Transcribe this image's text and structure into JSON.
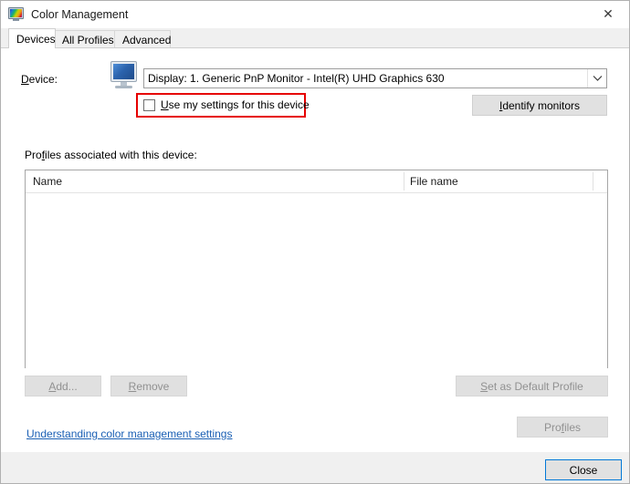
{
  "window": {
    "title": "Color Management",
    "icon": "color-monitor-icon",
    "close_glyph": "✕"
  },
  "tabs": [
    {
      "id": "devices",
      "label": "Devices",
      "selected": true
    },
    {
      "id": "all-profiles",
      "label": "All Profiles",
      "selected": false
    },
    {
      "id": "advanced",
      "label": "Advanced",
      "selected": false
    }
  ],
  "device_section": {
    "label": "Device:",
    "label_accel": "D",
    "icon": "monitor-icon",
    "combo_value": "Display: 1. Generic PnP Monitor - Intel(R) UHD Graphics 630",
    "combo_arrow_icon": "chevron-down-icon",
    "use_settings_label": "Use my settings for this device",
    "use_settings_accel": "U",
    "use_settings_checked": false,
    "identify_button": "Identify monitors",
    "identify_accel": "I",
    "highlight_color": "#e60000"
  },
  "profiles_section": {
    "label": "Profiles associated with this device:",
    "label_accel": "f",
    "columns": [
      "Name",
      "File name"
    ],
    "rows": [],
    "buttons": {
      "add": "Add...",
      "add_accel": "A",
      "remove": "Remove",
      "remove_accel": "R",
      "set_default": "Set as Default Profile",
      "set_default_accel": "S",
      "profiles": "Profiles",
      "profiles_accel": "f"
    }
  },
  "help_link": "Understanding color management settings",
  "footer": {
    "close_button": "Close"
  }
}
